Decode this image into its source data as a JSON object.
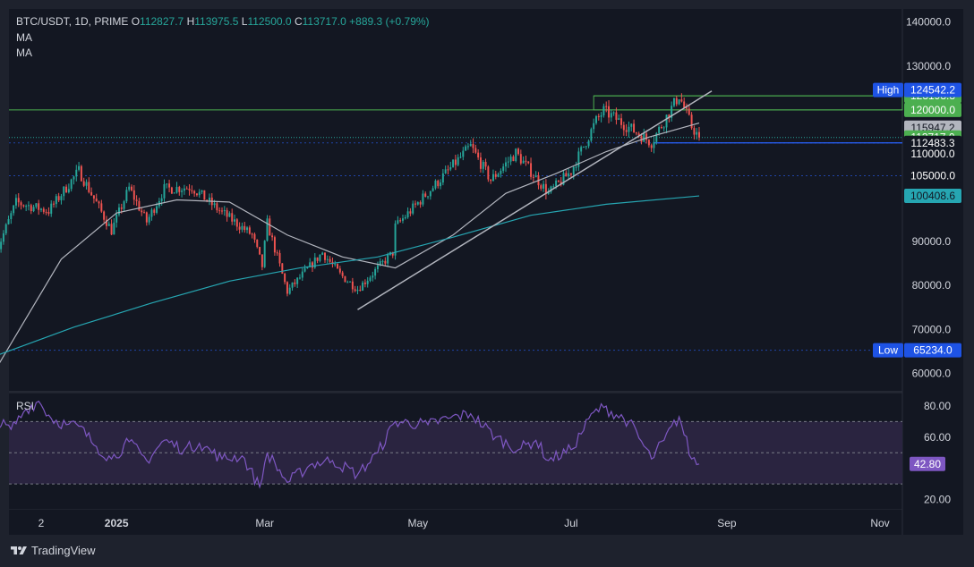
{
  "header": {
    "symbol": "BTC/USDT, 1D, PRIME",
    "open_label": "O",
    "open": "112827.7",
    "high_label": "H",
    "high": "113975.5",
    "low_label": "L",
    "low": "112500.0",
    "close_label": "C",
    "close": "113717.0",
    "change": "+889.3 (+0.79%)",
    "indicator_1": "MA",
    "indicator_2": "MA"
  },
  "rsi": {
    "title": "RSI"
  },
  "brand": {
    "name": "TradingView"
  },
  "colors": {
    "background": "#131722",
    "frame": "#1e222d",
    "up": "#26a69a",
    "down": "#ef5350",
    "ma_fast": "#b2b5be",
    "ma_slow": "#26a6b2",
    "trendline": "#b2b5be",
    "rsi_line": "#7e57c2",
    "rsi_band": "#2a2440",
    "text": "#d1d4dc"
  },
  "chart_data": [
    {
      "type": "candlestick",
      "title": "BTC/USDT, 1D, PRIME",
      "x_tick_labels": [
        "2",
        "2025",
        "Mar",
        "May",
        "Jul",
        "Sep",
        "Nov"
      ],
      "x_tick_dates": [
        "2024-12-02",
        "2025-01-01",
        "2025-03-01",
        "2025-05-01",
        "2025-07-01",
        "2025-09-01",
        "2025-11-01"
      ],
      "y_tick_labels": [
        "140000.0",
        "130000.0",
        "90000.0",
        "80000.0",
        "70000.0",
        "60000.0"
      ],
      "ylim": [
        56000,
        143000
      ],
      "grid": false,
      "close_series": [
        {
          "date": "2024-11-14",
          "close": 87500
        },
        {
          "date": "2024-11-22",
          "close": 98900
        },
        {
          "date": "2024-12-05",
          "close": 97000
        },
        {
          "date": "2024-12-17",
          "close": 106100
        },
        {
          "date": "2024-12-30",
          "close": 92500
        },
        {
          "date": "2025-01-06",
          "close": 102200
        },
        {
          "date": "2025-01-13",
          "close": 94500
        },
        {
          "date": "2025-01-20",
          "close": 102000
        },
        {
          "date": "2025-01-31",
          "close": 102400
        },
        {
          "date": "2025-02-10",
          "close": 97500
        },
        {
          "date": "2025-02-24",
          "close": 91500
        },
        {
          "date": "2025-02-28",
          "close": 84400
        },
        {
          "date": "2025-03-02",
          "close": 94200
        },
        {
          "date": "2025-03-10",
          "close": 78600
        },
        {
          "date": "2025-03-24",
          "close": 87500
        },
        {
          "date": "2025-03-31",
          "close": 82500
        },
        {
          "date": "2025-04-07",
          "close": 79200
        },
        {
          "date": "2025-04-21",
          "close": 87500
        },
        {
          "date": "2025-04-22",
          "close": 93400
        },
        {
          "date": "2025-05-08",
          "close": 103000
        },
        {
          "date": "2025-05-22",
          "close": 111700
        },
        {
          "date": "2025-05-30",
          "close": 104000
        },
        {
          "date": "2025-06-09",
          "close": 110200
        },
        {
          "date": "2025-06-22",
          "close": 101000
        },
        {
          "date": "2025-07-01",
          "close": 106000
        },
        {
          "date": "2025-07-11",
          "close": 117500
        },
        {
          "date": "2025-07-14",
          "close": 119800
        },
        {
          "date": "2025-08-02",
          "close": 112600
        },
        {
          "date": "2025-08-13",
          "close": 123300
        },
        {
          "date": "2025-08-18",
          "close": 116200
        },
        {
          "date": "2025-08-21",
          "close": 113717
        }
      ],
      "annotations": {
        "high": {
          "label": "High",
          "value": "124542.2"
        },
        "low": {
          "label": "Low",
          "value": "65234.0"
        },
        "price_labels": [
          {
            "value": "123198.8",
            "style": "green"
          },
          {
            "value": "120000.0",
            "style": "green"
          },
          {
            "value": "115947.2",
            "style": "gray"
          },
          {
            "value": "113717.0",
            "style": "green"
          },
          {
            "value": "112483.3",
            "style": "blue"
          },
          {
            "value": "110000.0",
            "style": "blue"
          },
          {
            "value": "105000.0",
            "style": "blue"
          },
          {
            "value": "100408.6",
            "style": "teal"
          }
        ]
      },
      "moving_averages": [
        {
          "points": [
            [
              "2024-11-14",
              61000
            ],
            [
              "2024-12-10",
              86000
            ],
            [
              "2025-01-01",
              96500
            ],
            [
              "2025-01-25",
              99500
            ],
            [
              "2025-02-15",
              99000
            ],
            [
              "2025-03-10",
              91500
            ],
            [
              "2025-04-01",
              86500
            ],
            [
              "2025-04-22",
              84000
            ],
            [
              "2025-05-15",
              91500
            ],
            [
              "2025-06-05",
              101000
            ],
            [
              "2025-06-25",
              105500
            ],
            [
              "2025-07-15",
              110500
            ],
            [
              "2025-08-01",
              113800
            ],
            [
              "2025-08-21",
              117000
            ]
          ]
        },
        {
          "points": [
            [
              "2024-11-14",
              64000
            ],
            [
              "2024-12-15",
              70500
            ],
            [
              "2025-01-15",
              76000
            ],
            [
              "2025-02-15",
              81000
            ],
            [
              "2025-03-15",
              84000
            ],
            [
              "2025-04-15",
              86500
            ],
            [
              "2025-05-15",
              91000
            ],
            [
              "2025-06-15",
              96000
            ],
            [
              "2025-07-15",
              98500
            ],
            [
              "2025-08-21",
              100400
            ]
          ]
        }
      ],
      "trendline": [
        [
          "2025-04-07",
          74500
        ],
        [
          "2025-08-26",
          124300
        ]
      ],
      "levels": [
        {
          "value": 123198.8,
          "style": "green-box"
        },
        {
          "value": 120000.0,
          "style": "green"
        },
        {
          "value": 112483.3,
          "style": "blue-dashed"
        },
        {
          "value": 105000.0,
          "style": "blue-dashed"
        },
        {
          "value": 113717.0,
          "style": "green-dotted"
        },
        {
          "value": 65234.0,
          "style": "blue-dashed"
        }
      ]
    },
    {
      "type": "line",
      "title": "RSI",
      "y_tick_labels": [
        "80.00",
        "60.00",
        "20.00"
      ],
      "ylim": [
        14,
        88
      ],
      "bands": [
        70,
        50,
        30
      ],
      "last_value": "42.80",
      "series": [
        {
          "values": [
            [
              "2024-11-14",
              70
            ],
            [
              "2024-11-20",
              65
            ],
            [
              "2024-11-26",
              78
            ],
            [
              "2024-12-01",
              83
            ],
            [
              "2024-12-06",
              72
            ],
            [
              "2024-12-12",
              68
            ],
            [
              "2024-12-17",
              67
            ],
            [
              "2024-12-24",
              54
            ],
            [
              "2024-12-30",
              46
            ],
            [
              "2025-01-06",
              57
            ],
            [
              "2025-01-13",
              45
            ],
            [
              "2025-01-20",
              58
            ],
            [
              "2025-01-28",
              52
            ],
            [
              "2025-02-03",
              56
            ],
            [
              "2025-02-12",
              46
            ],
            [
              "2025-02-20",
              48
            ],
            [
              "2025-02-27",
              28
            ],
            [
              "2025-03-02",
              50
            ],
            [
              "2025-03-10",
              31
            ],
            [
              "2025-03-20",
              43
            ],
            [
              "2025-03-28",
              45
            ],
            [
              "2025-04-07",
              36
            ],
            [
              "2025-04-15",
              50
            ],
            [
              "2025-04-22",
              70
            ],
            [
              "2025-05-05",
              68
            ],
            [
              "2025-05-13",
              72
            ],
            [
              "2025-05-22",
              75
            ],
            [
              "2025-06-01",
              60
            ],
            [
              "2025-06-10",
              52
            ],
            [
              "2025-06-17",
              58
            ],
            [
              "2025-06-22",
              45
            ],
            [
              "2025-07-01",
              52
            ],
            [
              "2025-07-10",
              76
            ],
            [
              "2025-07-14",
              79
            ],
            [
              "2025-07-24",
              70
            ],
            [
              "2025-08-02",
              46
            ],
            [
              "2025-08-07",
              58
            ],
            [
              "2025-08-13",
              73
            ],
            [
              "2025-08-18",
              46
            ],
            [
              "2025-08-21",
              42.8
            ]
          ]
        }
      ]
    }
  ]
}
